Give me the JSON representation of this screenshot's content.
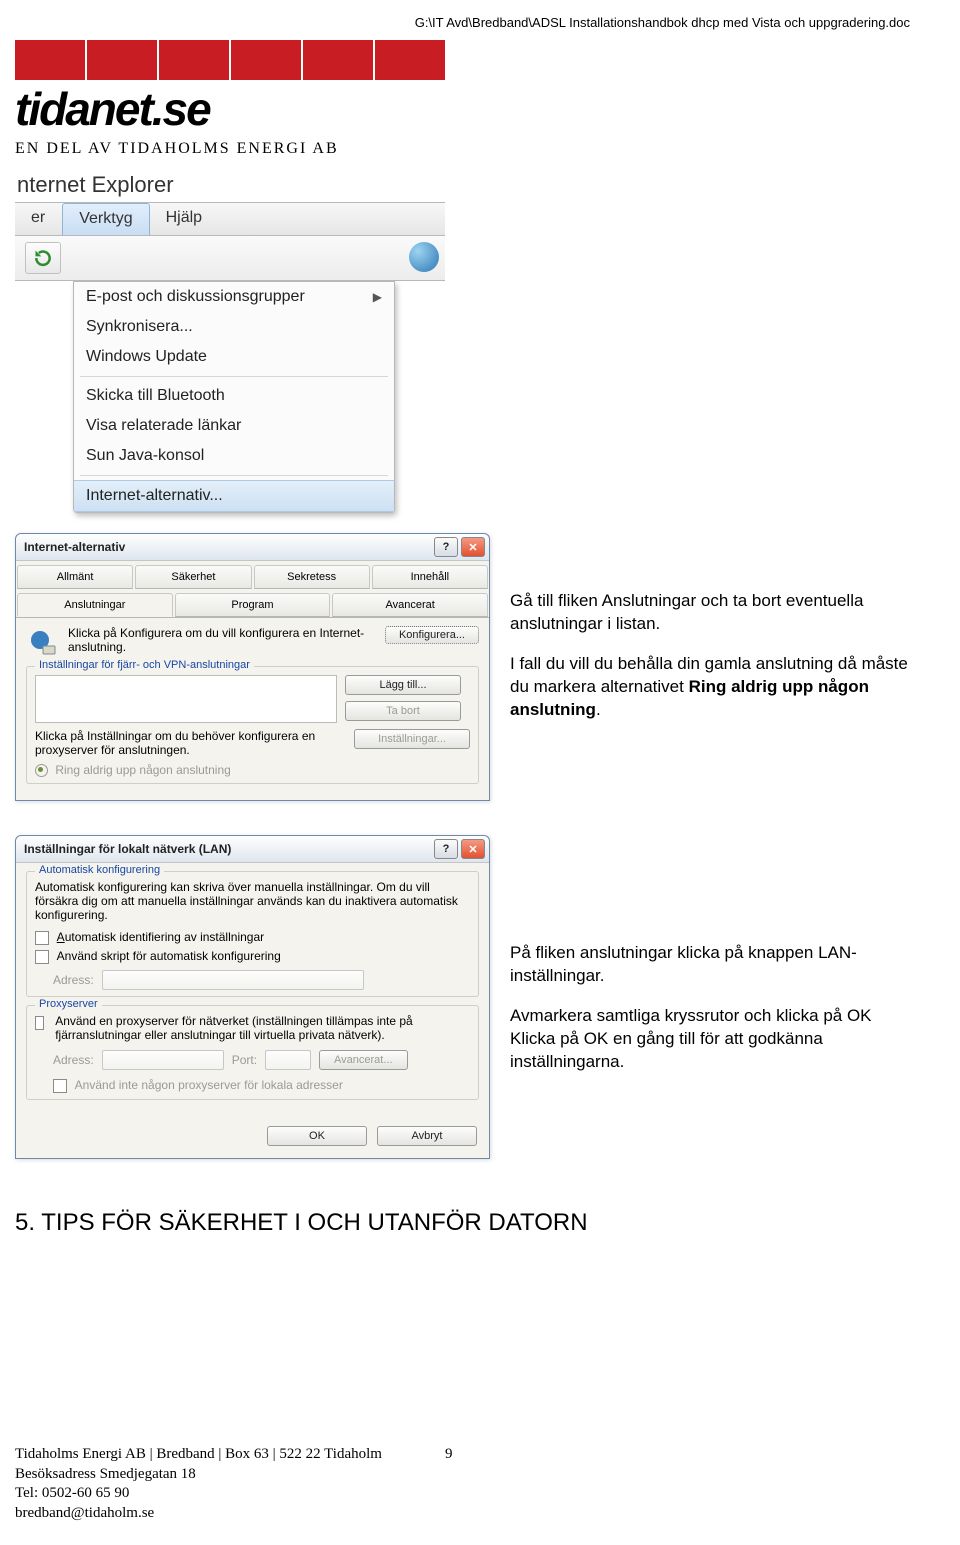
{
  "header_path": "G:\\IT Avd\\Bredband\\ADSL Installationshandbok dhcp med Vista och uppgradering.doc",
  "logo": {
    "text": "tidanet.se",
    "subtitle": "EN DEL AV TIDAHOLMS ENERGI AB"
  },
  "ie": {
    "title": "nternet Explorer",
    "menubar": {
      "item_left": "er",
      "verktyg": "Verktyg",
      "hjalp": "Hjälp"
    },
    "menu": {
      "epost": "E-post och diskussionsgrupper",
      "sync": "Synkronisera...",
      "winupd": "Windows Update",
      "bluetooth": "Skicka till Bluetooth",
      "relaterade": "Visa relaterade länkar",
      "java": "Sun Java-konsol",
      "internetalt": "Internet-alternativ..."
    }
  },
  "ia": {
    "title": "Internet-alternativ",
    "tabs": [
      "Allmänt",
      "Säkerhet",
      "Sekretess",
      "Innehåll",
      "Anslutningar",
      "Program",
      "Avancerat"
    ],
    "konfig_text": "Klicka på Konfigurera om du vill konfigurera en Internet-anslutning.",
    "btn_konfig": "Konfigurera...",
    "group_vpn": "Inställningar för fjärr- och VPN-anslutningar",
    "btn_lagg": "Lägg till...",
    "btn_tabort": "Ta bort",
    "proxy_text": "Klicka på Inställningar om du behöver konfigurera en proxyserver för anslutningen.",
    "btn_inst": "Inställningar...",
    "radio_ring": "Ring aldrig upp någon anslutning"
  },
  "instr1": {
    "p1": "Gå till fliken Anslutningar och ta bort eventuella anslutningar i listan.",
    "p2a": "I fall du vill du behålla din gamla anslutning då måste du markera alternativet ",
    "p2b": "Ring aldrig upp någon anslutning",
    "p2c": "."
  },
  "lan": {
    "title": "Inställningar för lokalt nätverk (LAN)",
    "group_auto": "Automatisk konfigurering",
    "auto_text": "Automatisk konfigurering kan skriva över manuella inställningar. Om du vill försäkra dig om att manuella inställningar används kan du inaktivera automatisk konfigurering.",
    "chk_auto": "Automatisk identifiering av inställningar",
    "chk_script": "Använd skript för automatisk konfigurering",
    "adress": "Adress:",
    "group_proxy": "Proxyserver",
    "chk_proxy": "Använd en proxyserver för nätverket (inställningen tillämpas inte på fjärranslutningar eller anslutningar till virtuella privata nätverk).",
    "port": "Port:",
    "btn_avanc": "Avancerat...",
    "chk_local": "Använd inte någon proxyserver för lokala adresser",
    "btn_ok": "OK",
    "btn_avbryt": "Avbryt"
  },
  "instr2": {
    "p1": "På fliken anslutningar klicka på knappen LAN-inställningar.",
    "p2": "Avmarkera samtliga kryssrutor och klicka på OK",
    "p3": "Klicka på OK en gång till för att godkänna inställningarna."
  },
  "section5": "5. TIPS FÖR SÄKERHET I OCH UTANFÖR DATORN",
  "footer": {
    "l1": "Tidaholms Energi AB | Bredband | Box 63 | 522 22 Tidaholm",
    "l2": "Besöksadress Smedjegatan 18",
    "l3": "Tel: 0502-60 65 90",
    "l4": "bredband@tidaholm.se",
    "page": "9"
  }
}
